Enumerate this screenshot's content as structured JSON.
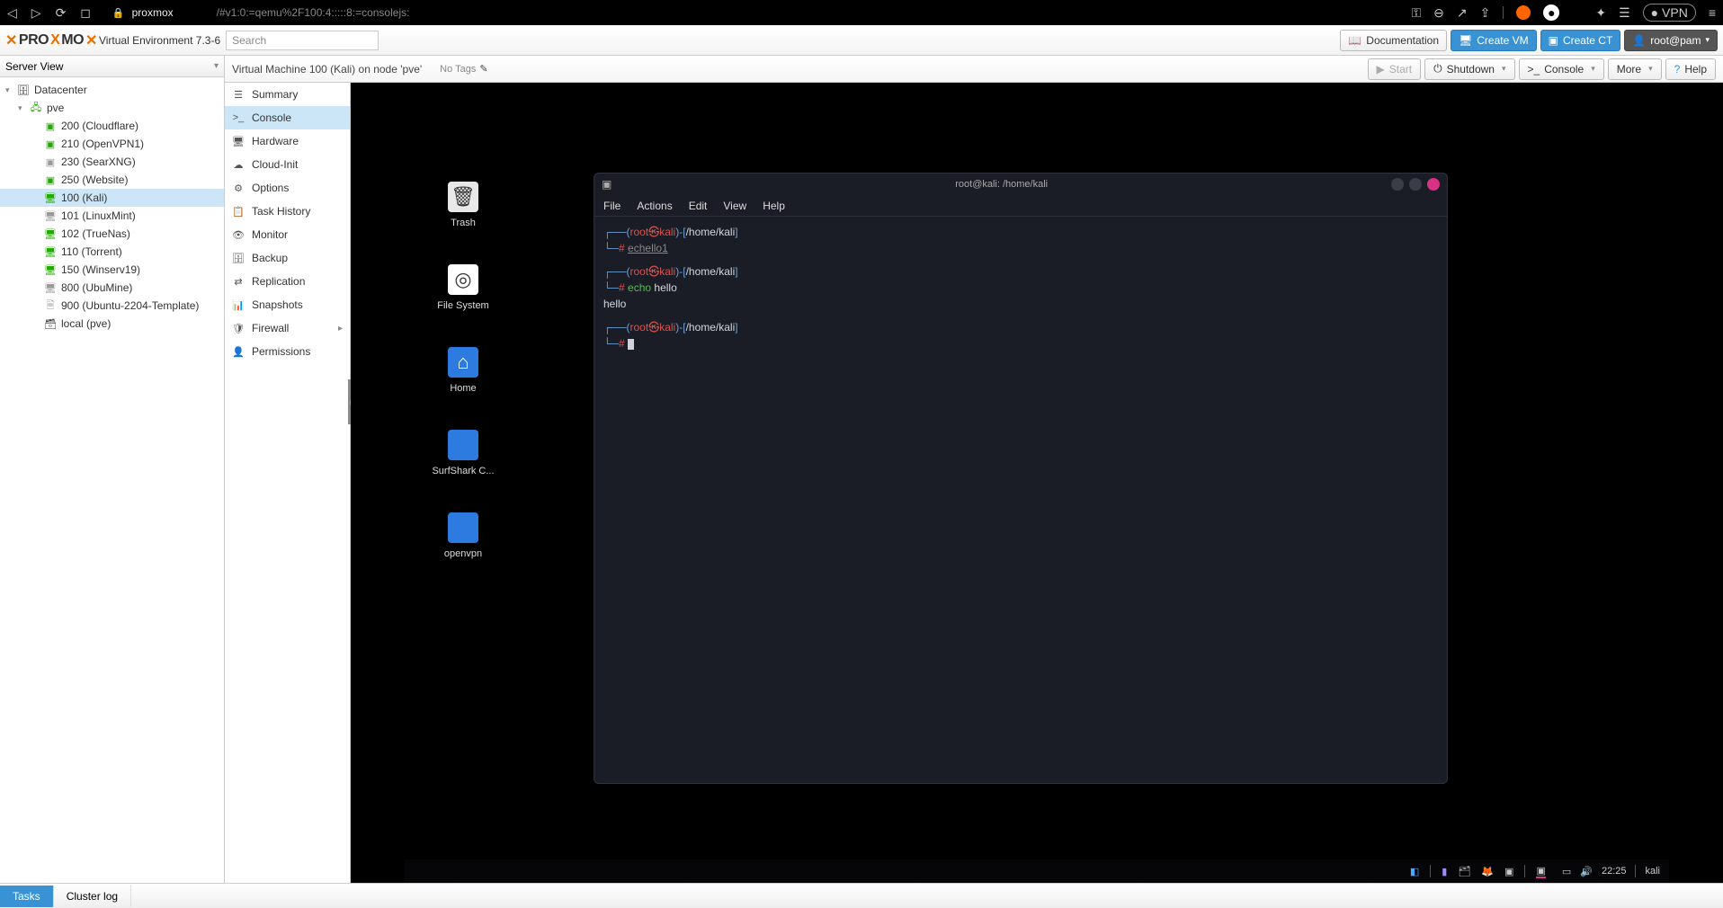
{
  "browser": {
    "host": "proxmox",
    "path": "/#v1:0:=qemu%2F100:4:::::8:=consolejs:",
    "vpn_label": "VPN"
  },
  "header": {
    "product": "PROXMOX",
    "version": "Virtual Environment 7.3-6",
    "search_placeholder": "Search",
    "documentation": "Documentation",
    "create_vm": "Create VM",
    "create_ct": "Create CT",
    "user": "root@pam"
  },
  "tree": {
    "view_label": "Server View",
    "datacenter": "Datacenter",
    "node": "pve",
    "vms": [
      {
        "label": "200 (Cloudflare)",
        "running": true,
        "type": "lxc"
      },
      {
        "label": "210 (OpenVPN1)",
        "running": true,
        "type": "lxc"
      },
      {
        "label": "230 (SearXNG)",
        "running": false,
        "type": "lxc"
      },
      {
        "label": "250 (Website)",
        "running": true,
        "type": "lxc"
      },
      {
        "label": "100 (Kali)",
        "running": true,
        "type": "qemu",
        "selected": true
      },
      {
        "label": "101 (LinuxMint)",
        "running": false,
        "type": "qemu"
      },
      {
        "label": "102 (TrueNas)",
        "running": true,
        "type": "qemu"
      },
      {
        "label": "110 (Torrent)",
        "running": true,
        "type": "qemu"
      },
      {
        "label": "150 (Winserv19)",
        "running": true,
        "type": "qemu"
      },
      {
        "label": "800 (UbuMine)",
        "running": false,
        "type": "qemu"
      },
      {
        "label": "900 (Ubuntu-2204-Template)",
        "running": false,
        "type": "template"
      }
    ],
    "storage": "local (pve)"
  },
  "vmHeader": {
    "title": "Virtual Machine 100 (Kali) on node 'pve'",
    "no_tags": "No Tags",
    "start": "Start",
    "shutdown": "Shutdown",
    "console": "Console",
    "more": "More",
    "help": "Help"
  },
  "vmNav": {
    "items": [
      {
        "label": "Summary",
        "icon": "☰"
      },
      {
        "label": "Console",
        "icon": ">_",
        "active": true
      },
      {
        "label": "Hardware",
        "icon": "🖥"
      },
      {
        "label": "Cloud-Init",
        "icon": "☁"
      },
      {
        "label": "Options",
        "icon": "⚙"
      },
      {
        "label": "Task History",
        "icon": "📋"
      },
      {
        "label": "Monitor",
        "icon": "👁"
      },
      {
        "label": "Backup",
        "icon": "🗄"
      },
      {
        "label": "Replication",
        "icon": "⇄"
      },
      {
        "label": "Snapshots",
        "icon": "📊"
      },
      {
        "label": "Firewall",
        "icon": "🛡",
        "chev": true
      },
      {
        "label": "Permissions",
        "icon": "👤"
      }
    ]
  },
  "desktop": {
    "icons": [
      {
        "label": "Trash",
        "kind": "trash"
      },
      {
        "label": "File System",
        "kind": "fs"
      },
      {
        "label": "Home",
        "kind": "home"
      },
      {
        "label": "SurfShark C...",
        "kind": "folder"
      },
      {
        "label": "openvpn",
        "kind": "folder"
      }
    ]
  },
  "terminal": {
    "title": "root@kali: /home/kali",
    "menus": [
      "File",
      "Actions",
      "Edit",
      "View",
      "Help"
    ],
    "prompt": {
      "user": "root",
      "at": "㉿",
      "host": "kali",
      "path": "/home/kali"
    },
    "line1_cmd": "echello1",
    "line2_cmd_a": "echo",
    "line2_cmd_b": "hello",
    "line2_out": "hello"
  },
  "taskbar": {
    "time": "22:25",
    "user": "kali"
  },
  "bottom": {
    "tasks": "Tasks",
    "cluster_log": "Cluster log"
  }
}
